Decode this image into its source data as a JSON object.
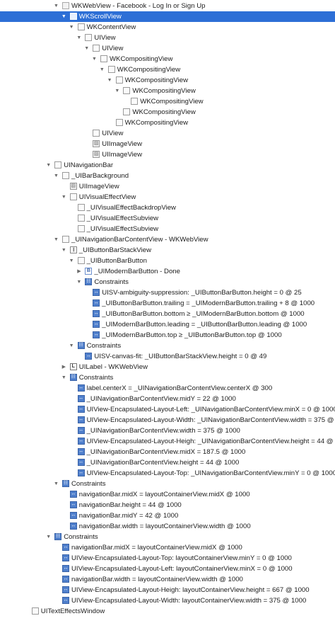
{
  "tree": [
    {
      "text": "WKWebView - Facebook - Log In or Sign Up",
      "icon": "web-view-icon",
      "toggle": "expanded",
      "depth": 0
    },
    {
      "text": "WKScrollView",
      "icon": "view-icon",
      "toggle": "expanded",
      "depth": 1,
      "selected": true
    },
    {
      "text": "WKContentView",
      "icon": "view-icon",
      "toggle": "expanded",
      "depth": 2
    },
    {
      "text": "UIView",
      "icon": "view-icon",
      "toggle": "expanded",
      "depth": 3
    },
    {
      "text": "UIView",
      "icon": "view-icon",
      "toggle": "expanded",
      "depth": 4
    },
    {
      "text": "WKCompositingView",
      "icon": "view-icon",
      "toggle": "expanded",
      "depth": 5
    },
    {
      "text": "WKCompositingView",
      "icon": "view-icon",
      "toggle": "expanded",
      "depth": 6
    },
    {
      "text": "WKCompositingView",
      "icon": "view-icon",
      "toggle": "expanded",
      "depth": 7
    },
    {
      "text": "WKCompositingView",
      "icon": "view-icon",
      "toggle": "expanded",
      "depth": 8
    },
    {
      "text": "WKCompositingView",
      "icon": "view-icon",
      "toggle": "none",
      "depth": 9
    },
    {
      "text": "WKCompositingView",
      "icon": "view-icon",
      "toggle": "none",
      "depth": 8
    },
    {
      "text": "WKCompositingView",
      "icon": "view-icon",
      "toggle": "none",
      "depth": 7
    },
    {
      "text": "UIView",
      "icon": "view-icon",
      "toggle": "none",
      "depth": 4
    },
    {
      "text": "UIImageView",
      "icon": "image-view-icon",
      "toggle": "none",
      "depth": 4
    },
    {
      "text": "UIImageView",
      "icon": "image-view-icon",
      "toggle": "none",
      "depth": 4
    },
    {
      "text": "UINavigationBar",
      "icon": "view-icon",
      "toggle": "expanded",
      "depth": -1
    },
    {
      "text": "_UIBarBackground",
      "icon": "view-icon",
      "toggle": "expanded",
      "depth": 0
    },
    {
      "text": "UIImageView",
      "icon": "image-view-icon",
      "toggle": "none",
      "depth": 1
    },
    {
      "text": "UIVisualEffectView",
      "icon": "view-icon",
      "toggle": "expanded",
      "depth": 1
    },
    {
      "text": "_UIVisualEffectBackdropView",
      "icon": "view-icon",
      "toggle": "none",
      "depth": 2
    },
    {
      "text": "_UIVisualEffectSubview",
      "icon": "view-icon",
      "toggle": "none",
      "depth": 2
    },
    {
      "text": "_UIVisualEffectSubview",
      "icon": "view-icon",
      "toggle": "none",
      "depth": 2
    },
    {
      "text": "_UINavigationBarContentView - WKWebView",
      "icon": "view-icon",
      "toggle": "expanded",
      "depth": 0
    },
    {
      "text": "_UIButtonBarStackView",
      "icon": "stack-view-icon",
      "toggle": "expanded",
      "depth": 1
    },
    {
      "text": "_UIButtonBarButton",
      "icon": "view-icon",
      "toggle": "expanded",
      "depth": 2
    },
    {
      "text": "_UIModernBarButton - Done",
      "icon": "button-icon",
      "toggle": "collapsed",
      "depth": 3
    },
    {
      "text": "Constraints",
      "icon": "constraints-icon",
      "toggle": "expanded",
      "depth": 3
    },
    {
      "text": "UISV-ambiguity-suppression: _UIButtonBarButton.height = 0 @ 25",
      "icon": "constraint-icon",
      "toggle": "none",
      "depth": 4
    },
    {
      "text": "_UIButtonBarButton.trailing = _UIModernBarButton.trailing + 8 @ 1000",
      "icon": "constraint-icon",
      "toggle": "none",
      "depth": 4
    },
    {
      "text": "_UIButtonBarButton.bottom ≥ _UIModernBarButton.bottom @ 1000",
      "icon": "constraint-icon",
      "toggle": "none",
      "depth": 4
    },
    {
      "text": "_UIModernBarButton.leading = _UIButtonBarButton.leading @ 1000",
      "icon": "constraint-icon",
      "toggle": "none",
      "depth": 4
    },
    {
      "text": "_UIModernBarButton.top ≥ _UIButtonBarButton.top @ 1000",
      "icon": "constraint-icon",
      "toggle": "none",
      "depth": 4
    },
    {
      "text": "Constraints",
      "icon": "constraints-icon",
      "toggle": "expanded",
      "depth": 2
    },
    {
      "text": "UISV-canvas-fit: _UIButtonBarStackView.height = 0 @ 49",
      "icon": "constraint-icon",
      "toggle": "none",
      "depth": 3
    },
    {
      "text": "UILabel - WKWebView",
      "icon": "label-icon",
      "toggle": "collapsed",
      "depth": 1
    },
    {
      "text": "Constraints",
      "icon": "constraints-icon",
      "toggle": "expanded",
      "depth": 1
    },
    {
      "text": "label.centerX = _UINavigationBarContentView.centerX @ 300",
      "icon": "constraint-icon",
      "toggle": "none",
      "depth": 2
    },
    {
      "text": "_UINavigationBarContentView.midY = 22 @ 1000",
      "icon": "constraint-icon",
      "toggle": "none",
      "depth": 2
    },
    {
      "text": "UIView-Encapsulated-Layout-Left: _UINavigationBarContentView.minX = 0 @ 1000",
      "icon": "constraint-icon",
      "toggle": "none",
      "depth": 2
    },
    {
      "text": "UIView-Encapsulated-Layout-Width: _UINavigationBarContentView.width = 375 @ 1000",
      "icon": "constraint-icon",
      "toggle": "none",
      "depth": 2
    },
    {
      "text": "_UINavigationBarContentView.width = 375 @ 1000",
      "icon": "constraint-icon",
      "toggle": "none",
      "depth": 2
    },
    {
      "text": "UIView-Encapsulated-Layout-Heigh: _UINavigationBarContentView.height = 44 @ 1000",
      "icon": "constraint-icon",
      "toggle": "none",
      "depth": 2
    },
    {
      "text": "_UINavigationBarContentView.midX = 187.5 @ 1000",
      "icon": "constraint-icon",
      "toggle": "none",
      "depth": 2
    },
    {
      "text": "_UINavigationBarContentView.height = 44 @ 1000",
      "icon": "constraint-icon",
      "toggle": "none",
      "depth": 2
    },
    {
      "text": "UIView-Encapsulated-Layout-Top: _UINavigationBarContentView.minY = 0 @ 1000",
      "icon": "constraint-icon",
      "toggle": "none",
      "depth": 2
    },
    {
      "text": "Constraints",
      "icon": "constraints-icon",
      "toggle": "expanded",
      "depth": 0
    },
    {
      "text": "navigationBar.midX = layoutContainerView.midX @ 1000",
      "icon": "constraint-icon",
      "toggle": "none",
      "depth": 1
    },
    {
      "text": "navigationBar.height = 44 @ 1000",
      "icon": "constraint-icon",
      "toggle": "none",
      "depth": 1
    },
    {
      "text": "navigationBar.midY = 42 @ 1000",
      "icon": "constraint-icon",
      "toggle": "none",
      "depth": 1
    },
    {
      "text": "navigationBar.width = layoutContainerView.width @ 1000",
      "icon": "constraint-icon",
      "toggle": "none",
      "depth": 1
    },
    {
      "text": "Constraints",
      "icon": "constraints-icon",
      "toggle": "expanded",
      "depth": -1
    },
    {
      "text": "navigationBar.midX = layoutContainerView.midX @ 1000",
      "icon": "constraint-icon",
      "toggle": "none",
      "depth": 0
    },
    {
      "text": "UIView-Encapsulated-Layout-Top: layoutContainerView.minY = 0 @ 1000",
      "icon": "constraint-icon",
      "toggle": "none",
      "depth": 0
    },
    {
      "text": "UIView-Encapsulated-Layout-Left: layoutContainerView.minX = 0 @ 1000",
      "icon": "constraint-icon",
      "toggle": "none",
      "depth": 0
    },
    {
      "text": "navigationBar.width = layoutContainerView.width @ 1000",
      "icon": "constraint-icon",
      "toggle": "none",
      "depth": 0
    },
    {
      "text": "UIView-Encapsulated-Layout-Heigh: layoutContainerView.height = 667 @ 1000",
      "icon": "constraint-icon",
      "toggle": "none",
      "depth": 0
    },
    {
      "text": "UIView-Encapsulated-Layout-Width: layoutContainerView.width = 375 @ 1000",
      "icon": "constraint-icon",
      "toggle": "none",
      "depth": 0
    },
    {
      "text": "UITextEffectsWindow",
      "icon": "view-icon",
      "toggle": "none",
      "depth": -4
    }
  ],
  "colors": {
    "selection": "#2d6fd6",
    "constraints_icon": "#4f7fcc",
    "text": "#1c1c1c",
    "background": "#ffffff"
  }
}
